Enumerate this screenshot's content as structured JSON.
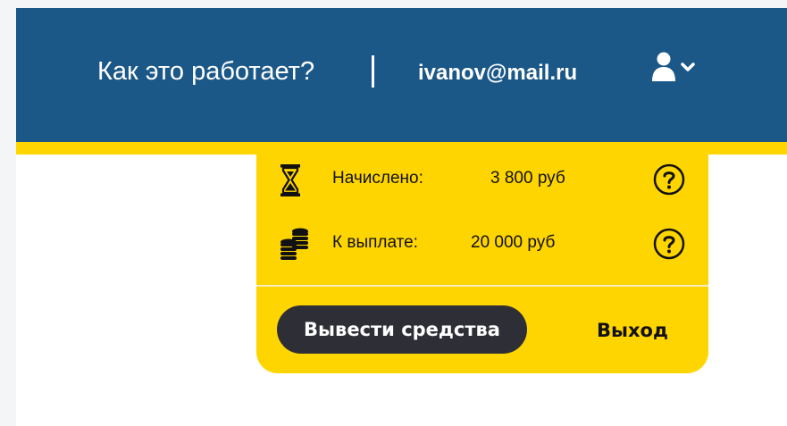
{
  "header": {
    "how_it_works_label": "Как это работает?",
    "user_email": "ivanov@mail.ru",
    "user_menu_icon": "user-icon",
    "chevron_icon": "chevron-down-icon"
  },
  "account_menu": {
    "accrued": {
      "icon": "hourglass-icon",
      "label": "Начислено:",
      "value": "3 800 руб"
    },
    "payable": {
      "icon": "coins-icon",
      "label": "К выплате:",
      "value": "20 000 руб"
    },
    "help_icon": "question-icon",
    "withdraw_label": "Вывести средства",
    "logout_label": "Выход"
  },
  "colors": {
    "header_bg": "#1b5888",
    "accent_yellow": "#ffd500",
    "button_dark": "#2e2f36",
    "text_white": "#ffffff"
  }
}
